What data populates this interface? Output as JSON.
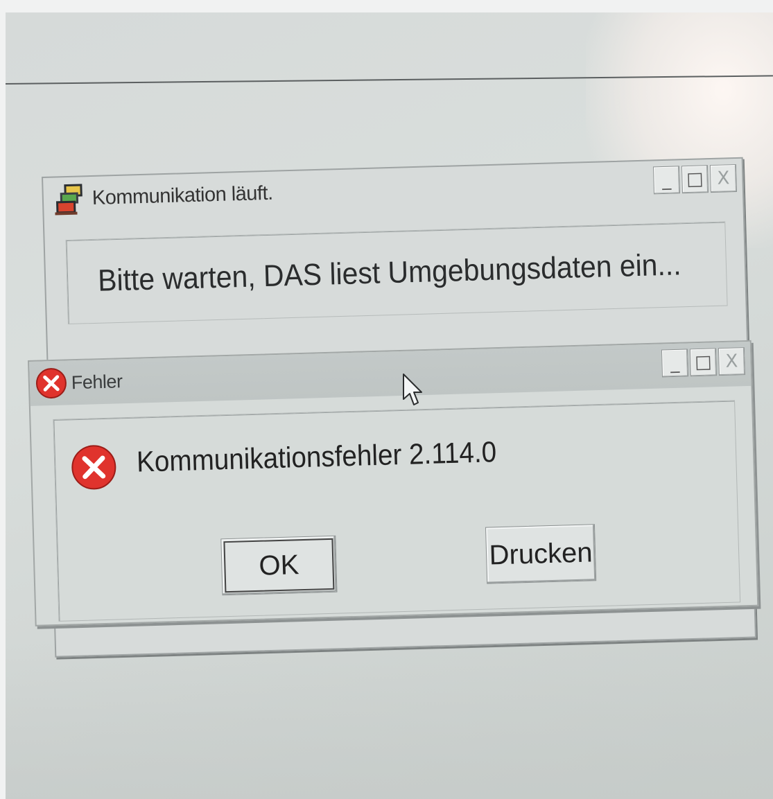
{
  "back_window": {
    "title": "Kommunikation läuft.",
    "message": "Bitte warten, DAS liest Umgebungsdaten ein...",
    "controls": {
      "minimize": "_",
      "maximize": "□",
      "close": "X"
    }
  },
  "error_dialog": {
    "title": "Fehler",
    "message": "Kommunikationsfehler 2.114.0",
    "buttons": {
      "ok_label": "OK",
      "print_label": "Drucken"
    },
    "controls": {
      "minimize": "_",
      "maximize": "□",
      "close": "X"
    }
  },
  "colors": {
    "error_red": "#e0332d",
    "window_bg": "#d6dbd9"
  },
  "icons": {
    "back_window_icon": "computer-stack-icon",
    "error_icon": "error-x-icon",
    "cursor": "arrow-cursor-icon"
  }
}
